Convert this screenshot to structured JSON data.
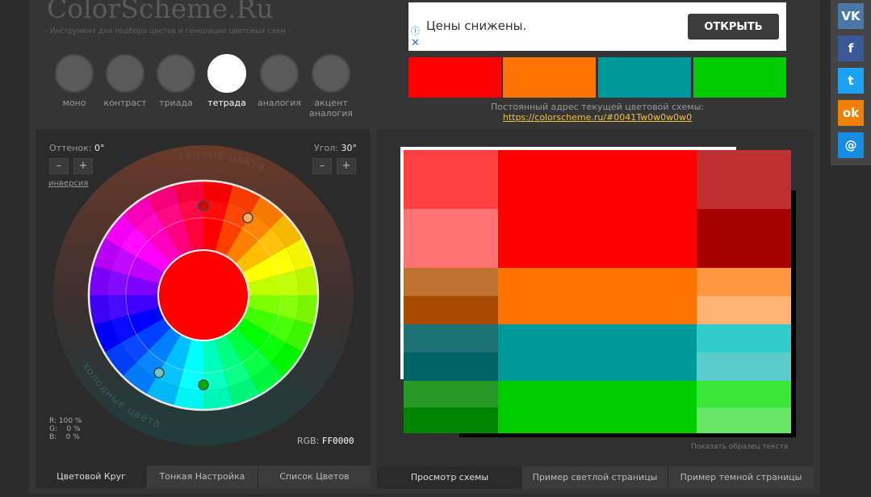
{
  "site": {
    "title": "ColorScheme.Ru",
    "subtitle": "· Инструмент для подбора цветов и генерации цветовых схем ·"
  },
  "modes": [
    {
      "label": "моно",
      "active": false
    },
    {
      "label": "контраст",
      "active": false
    },
    {
      "label": "триада",
      "active": false
    },
    {
      "label": "тетрада",
      "active": true
    },
    {
      "label": "аналогия",
      "active": false
    },
    {
      "label": "акцент аналогия",
      "active": false
    }
  ],
  "ad": {
    "text": "Цены снижены.",
    "button": "ОТКРЫТЬ",
    "info_icon": "ⓘ",
    "close_icon": "✕"
  },
  "scheme_swatches": [
    "#ff0000",
    "#ff7400",
    "#009999",
    "#00cc00"
  ],
  "permalink": {
    "label": "Постоянный адрес текущей цветовой схемы:",
    "url": "https://colorscheme.ru/#0041Tw0w0w0w0"
  },
  "controls": {
    "hue": {
      "label": "Оттенок:",
      "value": "0°"
    },
    "angle": {
      "label": "Угол:",
      "value": "30°"
    },
    "minus": "–",
    "plus": "+",
    "inversion": "инверсия"
  },
  "wheel": {
    "warm_label": "тёплые цвета",
    "cold_label": "холодные цвета",
    "selected_color": "#ff0000",
    "markers": [
      "#d80000",
      "#ffaa66",
      "#6cc6c6",
      "#00b000"
    ]
  },
  "rgb": {
    "r": "R: 100 %",
    "g": "G:    0 %",
    "b": "B:    0 %",
    "hex_label": "RGB:",
    "hex": "FF0000"
  },
  "left_tabs": [
    {
      "label": "Цветовой Круг",
      "active": true
    },
    {
      "label": "Тонкая Настройка",
      "active": false
    },
    {
      "label": "Список Цветов",
      "active": false
    }
  ],
  "right_tabs": [
    {
      "label": "Просмотр схемы",
      "active": true
    },
    {
      "label": "Пример светлой страницы",
      "active": false
    },
    {
      "label": "Пример темной страницы",
      "active": false
    }
  ],
  "palette": [
    [
      "#ff4040",
      "#ff0000",
      "#bf3030"
    ],
    [
      "#ff7373",
      "#ff0000",
      "#a60000"
    ],
    [
      "#bf7130",
      "#ff7400",
      "#ff9640"
    ],
    [
      "#a64b00",
      "#ff7400",
      "#ffb273"
    ],
    [
      "#1d7373",
      "#009999",
      "#33cccc"
    ],
    [
      "#006363",
      "#009999",
      "#5ccccc"
    ],
    [
      "#269926",
      "#00cc00",
      "#39e639"
    ],
    [
      "#008500",
      "#00cc00",
      "#67e667"
    ]
  ],
  "sample_text": "Показать образец текста",
  "social": [
    {
      "name": "vk-icon",
      "glyph": "VK",
      "color": "#4a76a8"
    },
    {
      "name": "facebook-icon",
      "glyph": "f",
      "color": "#3b5998"
    },
    {
      "name": "twitter-icon",
      "glyph": "t",
      "color": "#1da1f2"
    },
    {
      "name": "odnoklassniki-icon",
      "glyph": "ok",
      "color": "#ee8208"
    },
    {
      "name": "mail-icon",
      "glyph": "@",
      "color": "#168de2"
    }
  ]
}
